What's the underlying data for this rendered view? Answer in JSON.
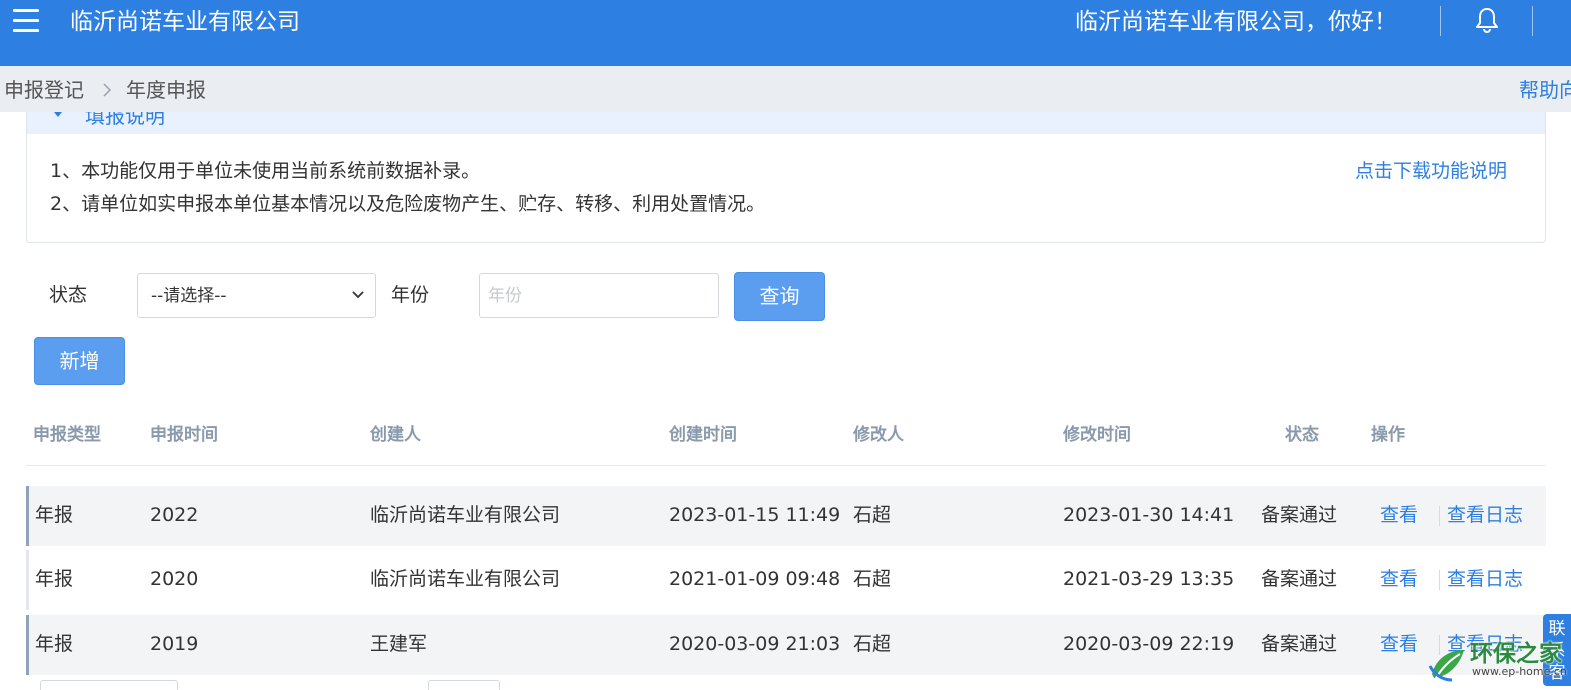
{
  "header": {
    "app_title": "临沂尚诺车业有限公司",
    "greeting": "临沂尚诺车业有限公司，你好！",
    "menu_icon": "hamburger-menu-icon",
    "bell_icon": "bell-icon",
    "colors": {
      "primary": "#2d7fe2"
    }
  },
  "breadcrumb": {
    "items": [
      "申报登记",
      "年度申报"
    ],
    "help_link": "帮助向"
  },
  "notice": {
    "title": "填报说明",
    "lines": [
      "1、本功能仅用于单位未使用当前系统前数据补录。",
      "2、请单位如实申报本单位基本情况以及危险废物产生、贮存、转移、利用处置情况。"
    ],
    "download_link": "点击下载功能说明"
  },
  "filters": {
    "status_label": "状态",
    "status_selected": "--请选择--",
    "year_label": "年份",
    "year_placeholder": "年份",
    "year_value": "",
    "query_button": "查询",
    "add_button": "新增"
  },
  "table": {
    "columns": [
      "申报类型",
      "申报时间",
      "创建人",
      "创建时间",
      "修改人",
      "修改时间",
      "状态",
      "操作"
    ],
    "rows": [
      {
        "type": "年报",
        "year": "2022",
        "creator": "临沂尚诺车业有限公司",
        "created": "2023-01-15 11:49",
        "modifier": "石超",
        "modified": "2023-01-30 14:41",
        "status": "备案通过",
        "action_view": "查看",
        "action_log": "查看日志"
      },
      {
        "type": "年报",
        "year": "2020",
        "creator": "临沂尚诺车业有限公司",
        "created": "2021-01-09 09:48",
        "modifier": "石超",
        "modified": "2021-03-29 13:35",
        "status": "备案通过",
        "action_view": "查看",
        "action_log": "查看日志"
      },
      {
        "type": "年报",
        "year": "2019",
        "creator": "王建军",
        "created": "2020-03-09 21:03",
        "modifier": "石超",
        "modified": "2020-03-09 22:19",
        "status": "备案通过",
        "action_view": "查看",
        "action_log": "查看日志"
      }
    ]
  },
  "side_tab": {
    "label": "联系客"
  },
  "watermark": {
    "brand": "环保之家",
    "url": "www.ep-home.cn"
  }
}
